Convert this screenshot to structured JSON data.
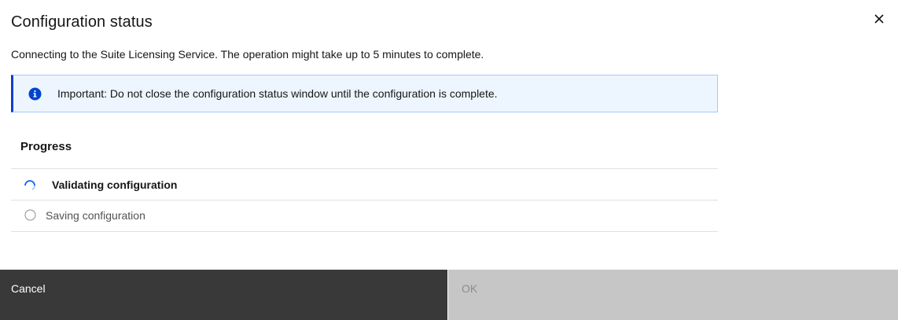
{
  "modal": {
    "title": "Configuration status",
    "close_icon": "close-icon",
    "subtitle": "Connecting to the Suite Licensing Service. The operation might take up to 5 minutes to complete."
  },
  "notification": {
    "kind": "info",
    "icon": "info-icon",
    "text": "Important: Do not close the configuration status window until the configuration is complete.",
    "colors": {
      "background": "#edf5ff",
      "border": "#a6c8ff",
      "accent": "#0043ce"
    }
  },
  "progress": {
    "heading": "Progress",
    "steps": [
      {
        "label": "Validating configuration",
        "status": "in-progress",
        "icon": "spinner-icon"
      },
      {
        "label": "Saving configuration",
        "status": "pending",
        "icon": "radio-empty-icon"
      }
    ]
  },
  "footer": {
    "cancel_label": "Cancel",
    "ok_label": "OK",
    "ok_disabled": true,
    "colors": {
      "cancel_bg": "#393939",
      "ok_bg_disabled": "#c6c6c6"
    }
  }
}
